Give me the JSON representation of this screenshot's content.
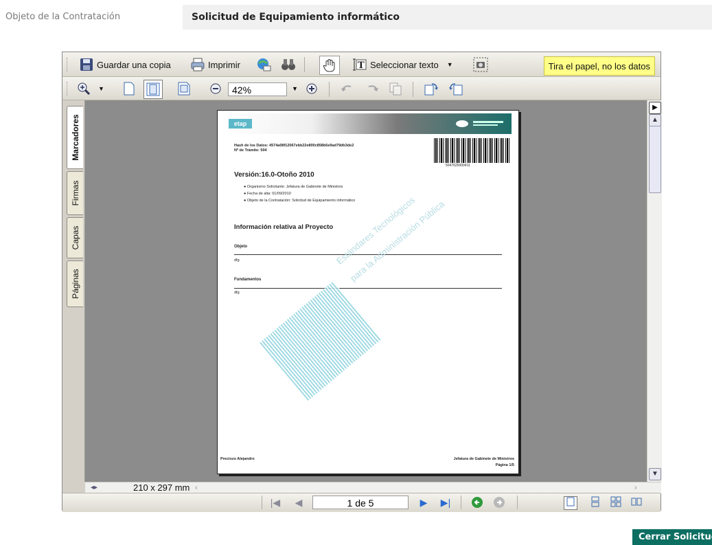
{
  "form": {
    "field_label": "Objeto de la Contratación",
    "field_value": "Solicitud de Equipamiento informático"
  },
  "toolbar": {
    "save_copy": "Guardar una copia",
    "print": "Imprimir",
    "select_text": "Seleccionar texto",
    "promo": "Tira el papel, no los datos",
    "zoom_value": "42%"
  },
  "sidetabs": [
    "Marcadores",
    "Firmas",
    "Capas",
    "Páginas"
  ],
  "document": {
    "header_logo": "etap",
    "hash_line1": "Hash de los Datos: 4574a08f12067ebb22e800c858b5e9ad79db3de2",
    "hash_line2": "Nº de Trámite: 504",
    "barcode_text": "5047625000411",
    "version": "Versión:16.0-Otoño 2010",
    "bullets": [
      "Organismo Solicitante: Jefatura de Gabinete de Ministros",
      "Fecha de alta: 01/09/2010",
      "Objeto de la Contratación: Solicitud de Equipamiento informático"
    ],
    "section_title": "Información relativa al Proyecto",
    "objeto_label": "Objeto",
    "objeto_value": "dfg",
    "fundamentos_label": "Fundamentos",
    "fundamentos_value": "dfg",
    "watermark_line1": "Estándares Tecnológicos",
    "watermark_line2": "para la Administración Pública",
    "footer_left": "Preciozo Alejandro",
    "footer_right1": "Jefatura de Gabinete de Ministros",
    "footer_right2": "Página 1/5"
  },
  "status": {
    "page_size": "210 x 297 mm",
    "page_indicator": "1 de 5"
  },
  "actions": {
    "close_label": "Cerrar Solicitud"
  }
}
